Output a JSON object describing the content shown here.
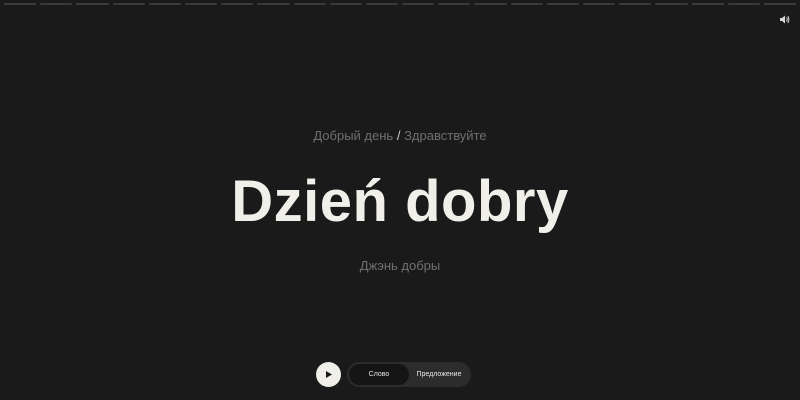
{
  "progress": {
    "total": 22,
    "completed": 0
  },
  "card": {
    "translation_a": "Добрый день",
    "separator": "/",
    "translation_b": "Здравствуйте",
    "word": "Dzień dobry",
    "transcription": "Джэнь добры"
  },
  "controls": {
    "mode_word": "Слово",
    "mode_sentence": "Предложение",
    "active_mode": "word"
  },
  "icons": {
    "sound": "speaker-icon",
    "play": "play-icon"
  },
  "colors": {
    "background": "#1a1a1a",
    "word": "#f0efe9",
    "muted_text": "#6f6f6f"
  }
}
